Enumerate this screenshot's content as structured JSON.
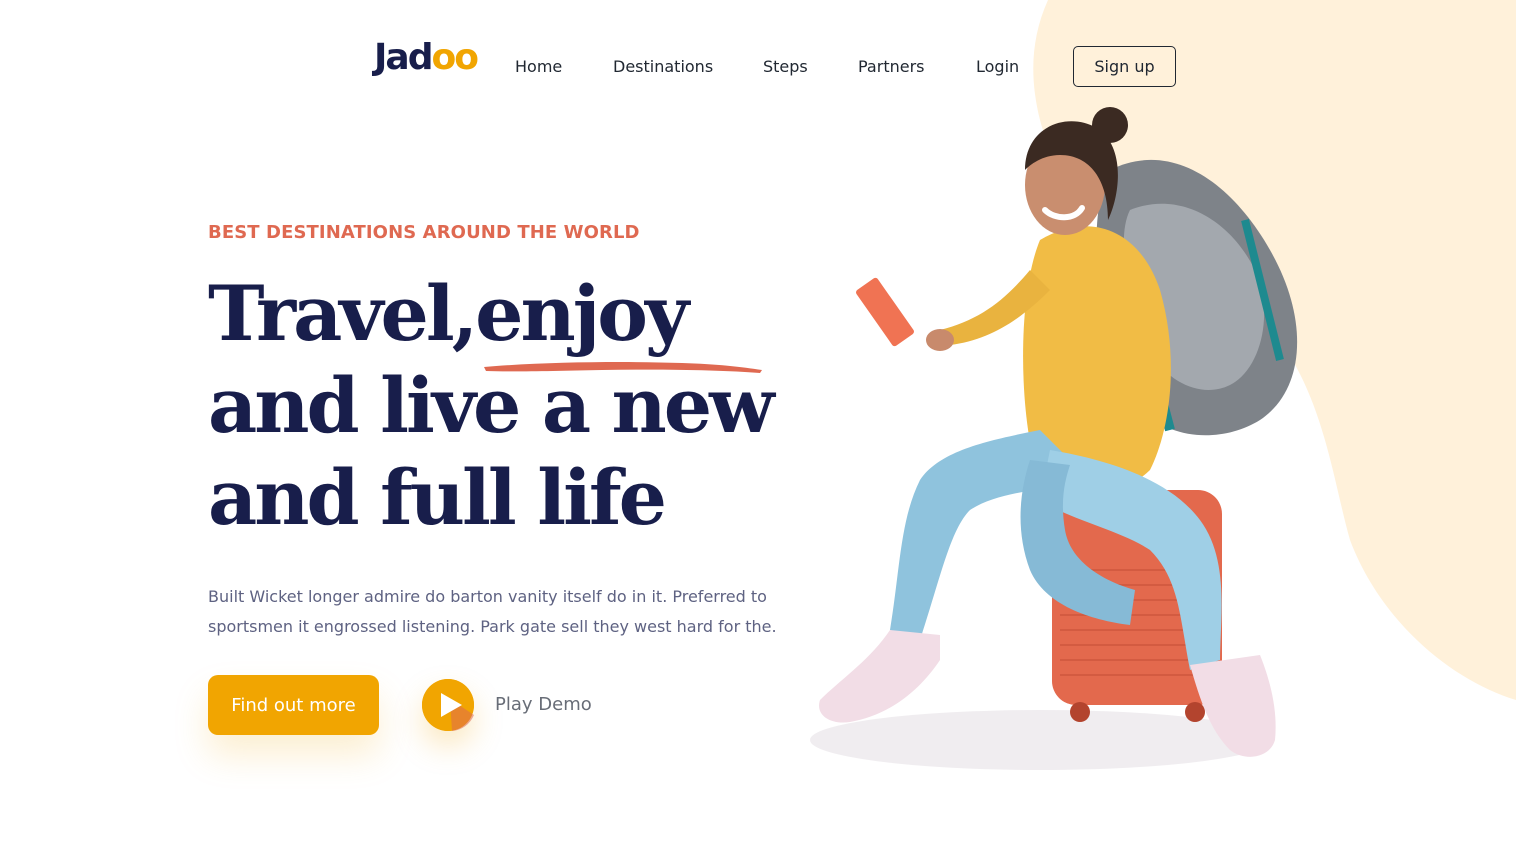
{
  "brand": {
    "logo_text": "Jad",
    "logo_accent": "oo",
    "accent_color": "#F1A501",
    "dark_color": "#181E4B"
  },
  "nav": {
    "items": [
      "Home",
      "Destinations",
      "Steps",
      "Partners",
      "Login"
    ],
    "signup_label": "Sign up"
  },
  "hero": {
    "kicker": "BEST DESTINATIONS AROUND THE WORLD",
    "kicker_color": "#DF6951",
    "headline_line1": "Travel,enjoy",
    "headline_line2": "and live a new",
    "headline_line3": "and full life",
    "description": "Built Wicket longer admire do barton vanity itself do in it. Preferred to sportsmen it engrossed listening. Park gate sell they west hard for the.",
    "cta_label": "Find out more",
    "play_label": "Play Demo"
  },
  "icons": {
    "play": "play-icon",
    "illustration": "traveller-illustration"
  },
  "colors": {
    "blob": "#FFF1DA"
  }
}
